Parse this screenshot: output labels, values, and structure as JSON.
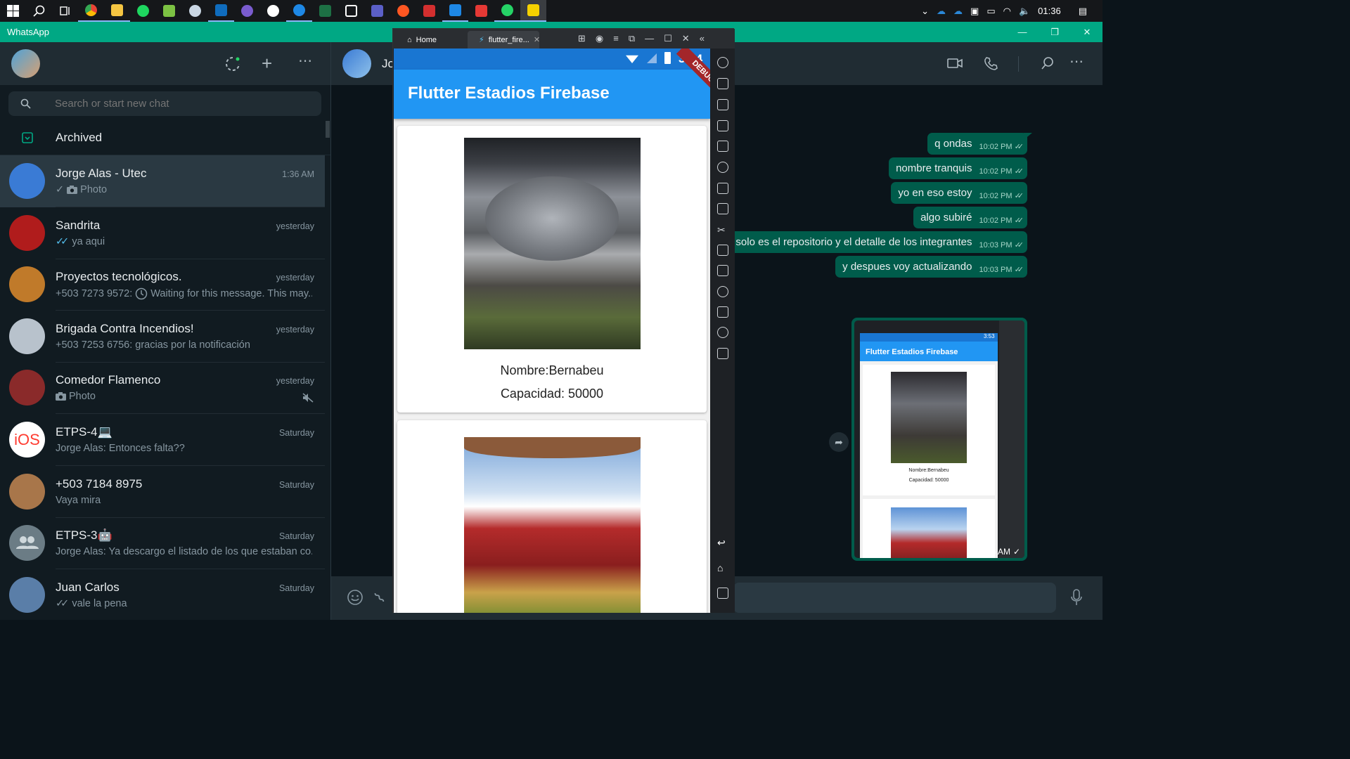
{
  "taskbar": {
    "apps": [
      "start",
      "search",
      "task-view",
      "chrome",
      "file-explorer",
      "spotify",
      "notepad",
      "app-a",
      "outlook",
      "app-b",
      "app-c",
      "app-d",
      "excel",
      "figma",
      "teams",
      "app-e",
      "app-f",
      "vscode",
      "app-g",
      "whatsapp",
      "app-h"
    ],
    "clock": "01:36"
  },
  "wa": {
    "title": "WhatsApp",
    "search_placeholder": "Search or start new chat",
    "archived_label": "Archived",
    "chats": [
      {
        "name": "Jorge Alas - Utec",
        "time": "1:36 AM",
        "msg": "Photo",
        "tick": "single",
        "photo": true,
        "color": "#3a7bd5"
      },
      {
        "name": "Sandrita",
        "time": "yesterday",
        "msg": "ya aqui",
        "tick": "double-blue",
        "photo": false,
        "color": "#b01c1c"
      },
      {
        "name": "Proyectos tecnológicos.",
        "time": "yesterday",
        "msg": "+503 7273 9572: ",
        "waiting": "Waiting for this message. This may...",
        "photo": false,
        "color": "#c07a2a"
      },
      {
        "name": "Brigada Contra Incendios!",
        "time": "yesterday",
        "msg": "+503 7253 6756: gracias por la notificación",
        "photo": false,
        "color": "#b8c2cc"
      },
      {
        "name": "Comedor Flamenco",
        "time": "yesterday",
        "msg": "Photo",
        "photo": true,
        "muted": true,
        "color": "#8a2a2a"
      },
      {
        "name": "ETPS-4💻",
        "time": "Saturday",
        "msg": "Jorge Alas: Entonces falta??",
        "photo": false,
        "color": "#ffffff",
        "avatar_text": "iOS"
      },
      {
        "name": "+503 7184 8975",
        "time": "Saturday",
        "msg": "Vaya mira",
        "photo": false,
        "color": "#a8764a"
      },
      {
        "name": "ETPS-3🤖",
        "time": "Saturday",
        "msg": "Jorge Alas: Ya descargo el listado de los que estaban co...",
        "photo": false,
        "color": "#6b7c85",
        "group_default": true
      },
      {
        "name": "Juan Carlos",
        "time": "Saturday",
        "msg": "vale la pena",
        "tick": "double-grey",
        "photo": false,
        "color": "#5a7ea8"
      }
    ],
    "conversation": {
      "contact_name": "Jo",
      "messages": [
        {
          "text": "q ondas",
          "time": "10:02 PM"
        },
        {
          "text": "nombre tranquis",
          "time": "10:02 PM"
        },
        {
          "text": "yo en eso estoy",
          "time": "10:02 PM"
        },
        {
          "text": "algo subiré",
          "time": "10:02 PM"
        },
        {
          "text": "o solo es el repositorio y el detalle de los integrantes",
          "time": "10:03 PM"
        },
        {
          "text": "y despues voy actualizando",
          "time": "10:03 PM"
        }
      ],
      "image_message": {
        "time": "1:36 AM",
        "preview_title": "Flutter Estadios Firebase",
        "preview_name": "Nombre:Bernabeu",
        "preview_capacity": "Capacidad: 50000",
        "preview_clock": "3:53"
      }
    }
  },
  "emulator": {
    "tab_home": "Home",
    "tab_app": "flutter_fire...",
    "clock": "3:54",
    "debug_label": "DEBUG",
    "app_title": "Flutter Estadios Firebase",
    "cards": [
      {
        "nombre": "Nombre:Bernabeu",
        "capacidad": "Capacidad: 50000"
      }
    ]
  },
  "colors": {
    "accent": "#00a884",
    "bubble_out": "#005c4b",
    "app_bar": "#2196f3"
  }
}
